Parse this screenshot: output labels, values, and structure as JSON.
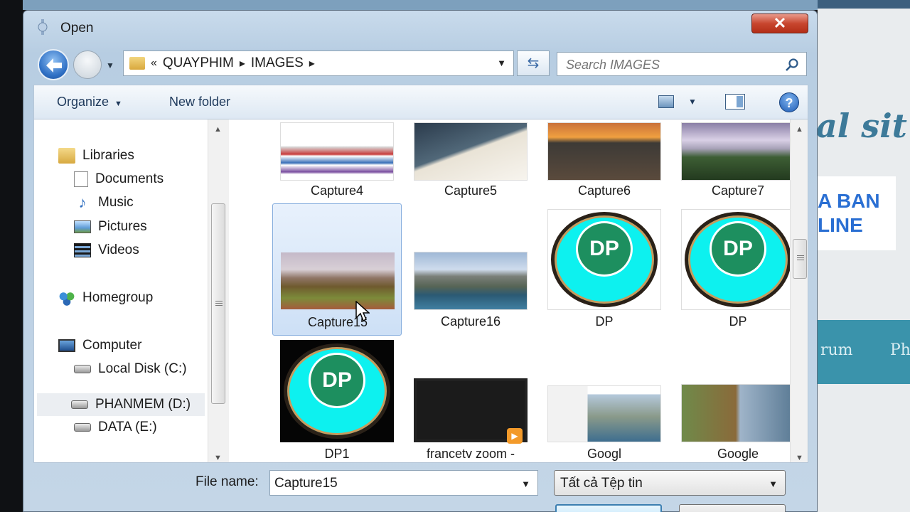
{
  "background": {
    "script_text": "al sit",
    "banner_lines": [
      "A BAN",
      "LINE"
    ],
    "nav_items": [
      "rum",
      "Ph"
    ]
  },
  "dialog": {
    "title": "Open",
    "close_label": "✕"
  },
  "address": {
    "overflow": "«",
    "crumbs": [
      "QUAYPHIM",
      "IMAGES"
    ]
  },
  "search": {
    "placeholder": "Search IMAGES"
  },
  "toolbar": {
    "organize_label": "Organize",
    "new_folder_label": "New folder",
    "help_label": "?"
  },
  "nav": {
    "items": [
      {
        "label": "Libraries",
        "icon": "libraries-icon"
      },
      {
        "label": "Documents",
        "icon": "documents-icon"
      },
      {
        "label": "Music",
        "icon": "music-icon"
      },
      {
        "label": "Pictures",
        "icon": "pictures-icon"
      },
      {
        "label": "Videos",
        "icon": "videos-icon"
      },
      {
        "label": "Homegroup",
        "icon": "homegroup-icon"
      },
      {
        "label": "Computer",
        "icon": "computer-icon"
      },
      {
        "label": "Local Disk (C:)",
        "icon": "drive-icon"
      },
      {
        "label": "PHANMEM (D:)",
        "icon": "drive-icon"
      },
      {
        "label": "DATA (E:)",
        "icon": "drive-icon"
      }
    ]
  },
  "files": [
    {
      "name": "Capture4"
    },
    {
      "name": "Capture5"
    },
    {
      "name": "Capture6"
    },
    {
      "name": "Capture7"
    },
    {
      "name": "Capture15"
    },
    {
      "name": "Capture16"
    },
    {
      "name": "DP"
    },
    {
      "name": "DP"
    },
    {
      "name": "DP1"
    },
    {
      "name": "francetv zoom -"
    },
    {
      "name": "Googl"
    },
    {
      "name": "Google"
    }
  ],
  "dp_logo_text": "DP",
  "bottom": {
    "file_name_label": "File name:",
    "file_name_value": "Capture15",
    "file_type_value": "Tất cả Tệp tin"
  },
  "colors": {
    "close": "#c8462f",
    "selection": "#cde0f6",
    "dp_cyan": "#0df1ef",
    "dp_green": "#1d8f5f"
  }
}
